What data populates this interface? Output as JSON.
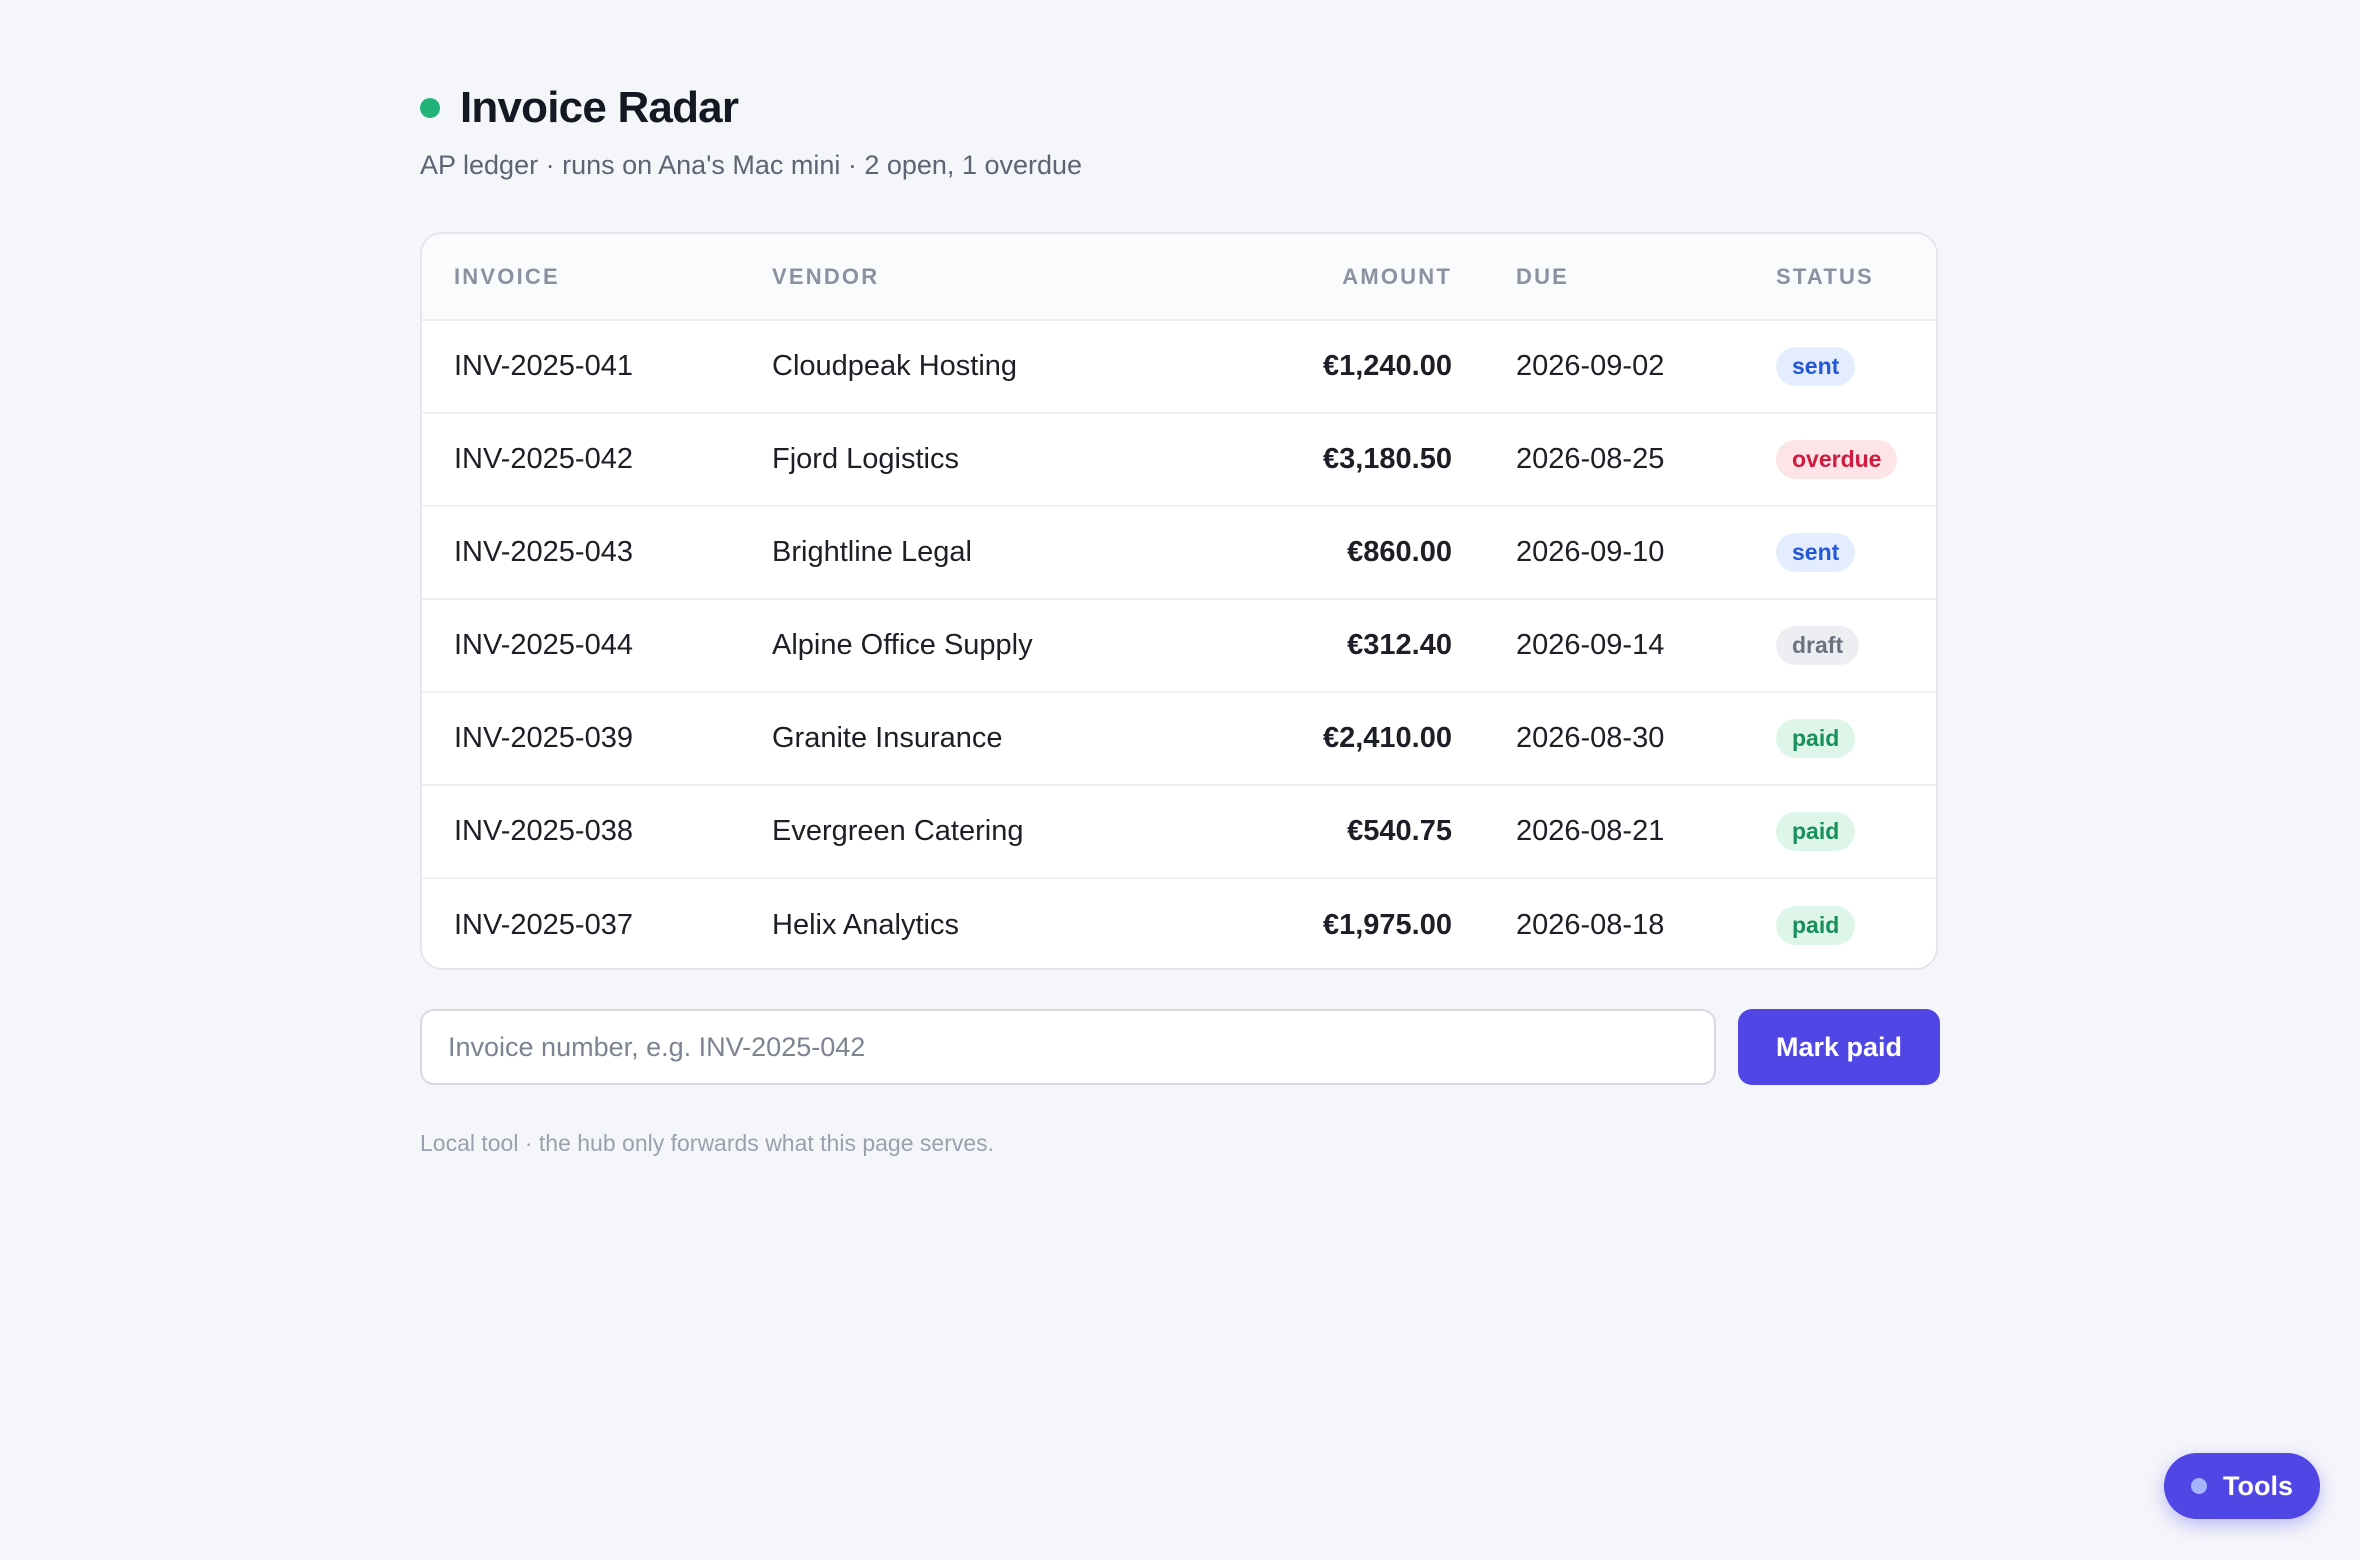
{
  "header": {
    "title": "Invoice Radar",
    "subtitle": "AP ledger · runs on Ana's Mac mini · 2 open, 1 overdue",
    "status_color": "#22b37a"
  },
  "table": {
    "columns": {
      "invoice": "INVOICE",
      "vendor": "VENDOR",
      "amount": "AMOUNT",
      "due": "DUE",
      "status": "STATUS"
    },
    "rows": [
      {
        "invoice": "INV-2025-041",
        "vendor": "Cloudpeak Hosting",
        "amount": "€1,240.00",
        "due": "2026-09-02",
        "status": "sent"
      },
      {
        "invoice": "INV-2025-042",
        "vendor": "Fjord Logistics",
        "amount": "€3,180.50",
        "due": "2026-08-25",
        "status": "overdue"
      },
      {
        "invoice": "INV-2025-043",
        "vendor": "Brightline Legal",
        "amount": "€860.00",
        "due": "2026-09-10",
        "status": "sent"
      },
      {
        "invoice": "INV-2025-044",
        "vendor": "Alpine Office Supply",
        "amount": "€312.40",
        "due": "2026-09-14",
        "status": "draft"
      },
      {
        "invoice": "INV-2025-039",
        "vendor": "Granite Insurance",
        "amount": "€2,410.00",
        "due": "2026-08-30",
        "status": "paid"
      },
      {
        "invoice": "INV-2025-038",
        "vendor": "Evergreen Catering",
        "amount": "€540.75",
        "due": "2026-08-21",
        "status": "paid"
      },
      {
        "invoice": "INV-2025-037",
        "vendor": "Helix Analytics",
        "amount": "€1,975.00",
        "due": "2026-08-18",
        "status": "paid"
      }
    ]
  },
  "actions": {
    "input_value": "",
    "input_placeholder": "Invoice number, e.g. INV-2025-042",
    "mark_paid_label": "Mark paid"
  },
  "footer": {
    "note": "Local tool · the hub only forwards what this page serves."
  },
  "tools": {
    "label": "Tools",
    "accent": "#4f46e5"
  },
  "status_colors": {
    "sent": "#2458d6",
    "overdue": "#d11a3e",
    "draft": "#6b7280",
    "paid": "#17905a"
  }
}
